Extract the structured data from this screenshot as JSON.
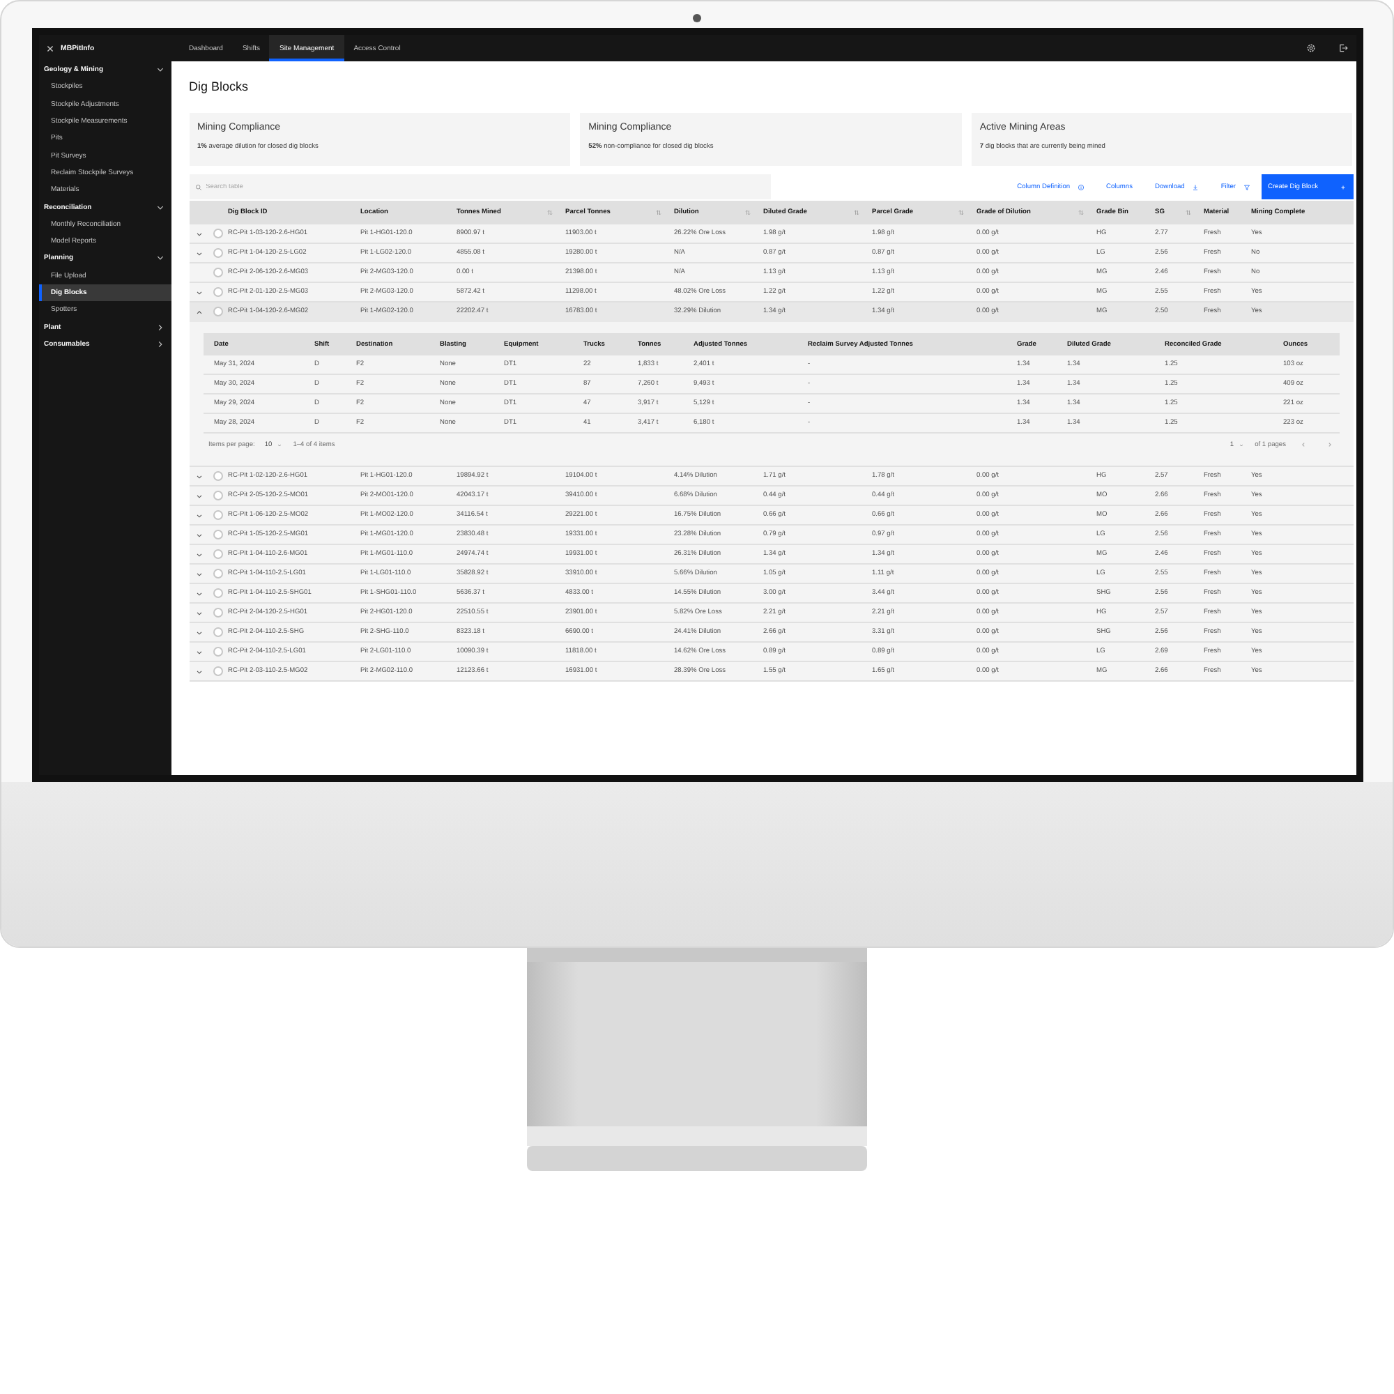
{
  "sidebar": {
    "brand": "MBPitInfo",
    "sections": [
      {
        "label": "Geology & Mining",
        "expanded": true,
        "children": [
          {
            "label": "Stockpiles",
            "selected": false
          },
          {
            "label": "Stockpile Adjustments",
            "selected": false
          },
          {
            "label": "Stockpile Measurements",
            "selected": false
          },
          {
            "label": "Pits",
            "selected": false
          },
          {
            "label": "Pit Surveys",
            "selected": false
          },
          {
            "label": "Reclaim Stockpile Surveys",
            "selected": false
          },
          {
            "label": "Materials",
            "selected": false
          }
        ]
      },
      {
        "label": "Reconciliation",
        "expanded": true,
        "children": [
          {
            "label": "Monthly Reconciliation",
            "selected": false
          },
          {
            "label": "Model Reports",
            "selected": false
          }
        ]
      },
      {
        "label": "Planning",
        "expanded": true,
        "children": [
          {
            "label": "File Upload",
            "selected": false
          },
          {
            "label": "Dig Blocks",
            "selected": true
          },
          {
            "label": "Spotters",
            "selected": false
          }
        ]
      },
      {
        "label": "Plant",
        "expanded": false
      },
      {
        "label": "Consumables",
        "expanded": false
      }
    ]
  },
  "tabs": [
    {
      "label": "Dashboard",
      "selected": false
    },
    {
      "label": "Shifts",
      "selected": false
    },
    {
      "label": "Site Management",
      "selected": true
    },
    {
      "label": "Access Control",
      "selected": false
    }
  ],
  "title": "Dig Blocks",
  "cards": [
    {
      "title": "Mining Compliance",
      "text": "**1%** average dilution for closed dig blocks"
    },
    {
      "title": "Mining Compliance",
      "text": "**52%** non-compliance for closed dig blocks"
    },
    {
      "title": "Active Mining Areas",
      "text": "**7** dig blocks that are currently being mined"
    }
  ],
  "toolbar": {
    "search": {
      "placeholder": "Search table"
    },
    "column_definition": "Column Definition",
    "columns": "Columns",
    "download": "Download",
    "filter": "Filter",
    "create_button": "Create Dig Block"
  },
  "table": {
    "columns": [
      {
        "label": "Dig Block ID",
        "sortable": false
      },
      {
        "label": "Location",
        "sortable": false
      },
      {
        "label": "Tonnes Mined",
        "sortable": true
      },
      {
        "label": "Parcel Tonnes",
        "sortable": true
      },
      {
        "label": "Dilution",
        "sortable": true
      },
      {
        "label": "Diluted Grade",
        "sortable": true
      },
      {
        "label": "Parcel Grade",
        "sortable": true
      },
      {
        "label": "Grade of Dilution",
        "sortable": true
      },
      {
        "label": "Grade Bin",
        "sortable": false
      },
      {
        "label": "SG",
        "sortable": true
      },
      {
        "label": "Material",
        "sortable": false
      },
      {
        "label": "Mining Complete",
        "sortable": false
      }
    ],
    "rows": [
      {
        "expandable": true,
        "expanded": false,
        "selected": false,
        "cells": [
          "RC-Pit 1-03-120-2.6-HG01",
          "Pit 1-HG01-120.0",
          "8900.97 t",
          "11903.00 t",
          "26.22% Ore Loss",
          "1.98 g/t",
          "1.98 g/t",
          "0.00 g/t",
          "HG",
          "2.77",
          "Fresh",
          "Yes"
        ]
      },
      {
        "expandable": true,
        "expanded": false,
        "selected": false,
        "cells": [
          "RC-Pit 1-04-120-2.5-LG02",
          "Pit 1-LG02-120.0",
          "4855.08 t",
          "19280.00 t",
          "N/A",
          "0.87 g/t",
          "0.87 g/t",
          "0.00 g/t",
          "LG",
          "2.56",
          "Fresh",
          "No"
        ]
      },
      {
        "expandable": false,
        "expanded": false,
        "selected": false,
        "cells": [
          "RC-Pit 2-06-120-2.6-MG03",
          "Pit 2-MG03-120.0",
          "0.00 t",
          "21398.00 t",
          "N/A",
          "1.13 g/t",
          "1.13 g/t",
          "0.00 g/t",
          "MG",
          "2.46",
          "Fresh",
          "No"
        ]
      },
      {
        "expandable": true,
        "expanded": false,
        "selected": false,
        "cells": [
          "RC-Pit 2-01-120-2.5-MG03",
          "Pit 2-MG03-120.0",
          "5872.42 t",
          "11298.00 t",
          "48.02% Ore Loss",
          "1.22 g/t",
          "1.22 g/t",
          "0.00 g/t",
          "MG",
          "2.55",
          "Fresh",
          "Yes"
        ]
      },
      {
        "expandable": true,
        "expanded": true,
        "selected": false,
        "cells": [
          "RC-Pit 1-04-120-2.6-MG02",
          "Pit 1-MG02-120.0",
          "22202.47 t",
          "16783.00 t",
          "32.29% Dilution",
          "1.34 g/t",
          "1.34 g/t",
          "0.00 g/t",
          "MG",
          "2.50",
          "Fresh",
          "Yes"
        ],
        "detail": {
          "columns": [
            "Date",
            "Shift",
            "Destination",
            "Blasting",
            "Equipment",
            "Trucks",
            "Tonnes",
            "Adjusted Tonnes",
            "Reclaim Survey Adjusted Tonnes",
            "Grade",
            "Diluted Grade",
            "Reconciled Grade",
            "Ounces"
          ],
          "rows": [
            [
              "May 31, 2024",
              "D",
              "F2",
              "None",
              "DT1",
              "22",
              "1,833 t",
              "2,401 t",
              "-",
              "1.34",
              "1.34",
              "1.25",
              "103 oz"
            ],
            [
              "May 30, 2024",
              "D",
              "F2",
              "None",
              "DT1",
              "87",
              "7,260 t",
              "9,493 t",
              "-",
              "1.34",
              "1.34",
              "1.25",
              "409 oz"
            ],
            [
              "May 29, 2024",
              "D",
              "F2",
              "None",
              "DT1",
              "47",
              "3,917 t",
              "5,129 t",
              "-",
              "1.34",
              "1.34",
              "1.25",
              "221 oz"
            ],
            [
              "May 28, 2024",
              "D",
              "F2",
              "None",
              "DT1",
              "41",
              "3,417 t",
              "6,180 t",
              "-",
              "1.34",
              "1.34",
              "1.25",
              "223 oz"
            ]
          ],
          "pagination": {
            "items_per_page_label": "Items per page:",
            "page_size": "10",
            "range": "1–4 of 4 items",
            "page": "1",
            "pages": "of 1 pages"
          }
        }
      },
      {
        "expandable": true,
        "expanded": false,
        "selected": false,
        "cells": [
          "RC-Pit 1-02-120-2.6-HG01",
          "Pit 1-HG01-120.0",
          "19894.92 t",
          "19104.00 t",
          "4.14% Dilution",
          "1.71 g/t",
          "1.78 g/t",
          "0.00 g/t",
          "HG",
          "2.57",
          "Fresh",
          "Yes"
        ]
      },
      {
        "expandable": true,
        "expanded": false,
        "selected": false,
        "cells": [
          "RC-Pit 2-05-120-2.5-MO01",
          "Pit 2-MO01-120.0",
          "42043.17 t",
          "39410.00 t",
          "6.68% Dilution",
          "0.44 g/t",
          "0.44 g/t",
          "0.00 g/t",
          "MO",
          "2.66",
          "Fresh",
          "Yes"
        ]
      },
      {
        "expandable": true,
        "expanded": false,
        "selected": false,
        "cells": [
          "RC-Pit 1-06-120-2.5-MO02",
          "Pit 1-MO02-120.0",
          "34116.54 t",
          "29221.00 t",
          "16.75% Dilution",
          "0.66 g/t",
          "0.66 g/t",
          "0.00 g/t",
          "MO",
          "2.66",
          "Fresh",
          "Yes"
        ]
      },
      {
        "expandable": true,
        "expanded": false,
        "selected": false,
        "cells": [
          "RC-Pit 1-05-120-2.5-MG01",
          "Pit 1-MG01-120.0",
          "23830.48 t",
          "19331.00 t",
          "23.28% Dilution",
          "0.79 g/t",
          "0.97 g/t",
          "0.00 g/t",
          "LG",
          "2.56",
          "Fresh",
          "Yes"
        ]
      },
      {
        "expandable": true,
        "expanded": false,
        "selected": false,
        "cells": [
          "RC-Pit 1-04-110-2.6-MG01",
          "Pit 1-MG01-110.0",
          "24974.74 t",
          "19931.00 t",
          "26.31% Dilution",
          "1.34 g/t",
          "1.34 g/t",
          "0.00 g/t",
          "MG",
          "2.46",
          "Fresh",
          "Yes"
        ]
      },
      {
        "expandable": true,
        "expanded": false,
        "selected": false,
        "cells": [
          "RC-Pit 1-04-110-2.5-LG01",
          "Pit 1-LG01-110.0",
          "35828.92 t",
          "33910.00 t",
          "5.66% Dilution",
          "1.05 g/t",
          "1.11 g/t",
          "0.00 g/t",
          "LG",
          "2.55",
          "Fresh",
          "Yes"
        ]
      },
      {
        "expandable": true,
        "expanded": false,
        "selected": false,
        "cells": [
          "RC-Pit 1-04-110-2.5-SHG01",
          "Pit 1-SHG01-110.0",
          "5636.37 t",
          "4833.00 t",
          "14.55% Dilution",
          "3.00 g/t",
          "3.44 g/t",
          "0.00 g/t",
          "SHG",
          "2.56",
          "Fresh",
          "Yes"
        ]
      },
      {
        "expandable": true,
        "expanded": false,
        "selected": false,
        "cells": [
          "RC-Pit 2-04-120-2.5-HG01",
          "Pit 2-HG01-120.0",
          "22510.55 t",
          "23901.00 t",
          "5.82% Ore Loss",
          "2.21 g/t",
          "2.21 g/t",
          "0.00 g/t",
          "HG",
          "2.57",
          "Fresh",
          "Yes"
        ]
      },
      {
        "expandable": true,
        "expanded": false,
        "selected": false,
        "cells": [
          "RC-Pit 2-04-110-2.5-SHG",
          "Pit 2-SHG-110.0",
          "8323.18 t",
          "6690.00 t",
          "24.41% Dilution",
          "2.66 g/t",
          "3.31 g/t",
          "0.00 g/t",
          "SHG",
          "2.56",
          "Fresh",
          "Yes"
        ]
      },
      {
        "expandable": true,
        "expanded": false,
        "selected": false,
        "cells": [
          "RC-Pit 2-04-110-2.5-LG01",
          "Pit 2-LG01-110.0",
          "10090.39 t",
          "11818.00 t",
          "14.62% Ore Loss",
          "0.89 g/t",
          "0.89 g/t",
          "0.00 g/t",
          "LG",
          "2.69",
          "Fresh",
          "Yes"
        ]
      },
      {
        "expandable": true,
        "expanded": false,
        "selected": false,
        "cells": [
          "RC-Pit 2-03-110-2.5-MG02",
          "Pit 2-MG02-110.0",
          "12123.66 t",
          "16931.00 t",
          "28.39% Ore Loss",
          "1.55 g/t",
          "1.65 g/t",
          "0.00 g/t",
          "MG",
          "2.66",
          "Fresh",
          "Yes"
        ]
      }
    ]
  }
}
